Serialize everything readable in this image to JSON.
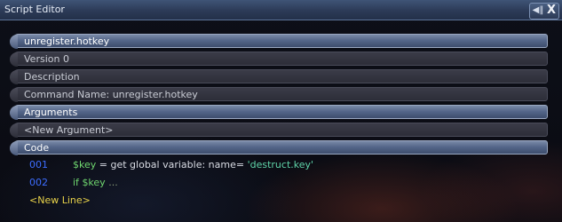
{
  "window": {
    "title": "Script Editor",
    "collapse_icon": "collapse-icon",
    "close_label": "X"
  },
  "rows": {
    "script_name": "unregister.hotkey",
    "version": "Version 0",
    "description": "Description",
    "command_name": "Command Name: unregister.hotkey",
    "arguments_header": "Arguments",
    "new_argument": "<New Argument>",
    "code_header": "Code"
  },
  "code": {
    "lines": [
      {
        "number": "001",
        "var": "$key",
        "op": "=",
        "text": "get global variable: name=",
        "string": "'destruct.key'"
      },
      {
        "number": "002",
        "keyword": "if",
        "var": "$key",
        "ellipsis": "..."
      }
    ],
    "new_line": "<New Line>"
  },
  "colors": {
    "header_blue": "#55678a",
    "line_number": "#3d6dff",
    "keyword_green": "#6fd66f",
    "string_teal": "#5fd3a8",
    "new_line_yellow": "#e8d24a"
  }
}
